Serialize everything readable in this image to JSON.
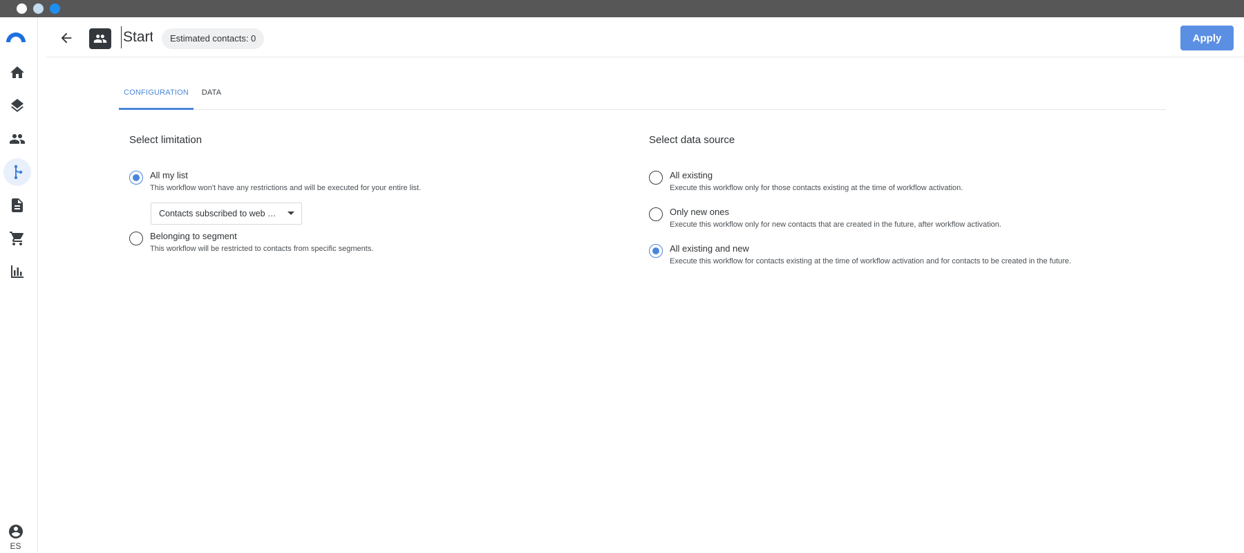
{
  "window": {
    "dots": [
      "#ffffff",
      "#c3dcef",
      "#1d8ff0"
    ]
  },
  "sidebar": {
    "items": [
      {
        "name": "home",
        "icon": "home-icon"
      },
      {
        "name": "layers",
        "icon": "layers-icon"
      },
      {
        "name": "contacts",
        "icon": "people-icon"
      },
      {
        "name": "workflows",
        "icon": "workflow-branch-icon",
        "active": true
      },
      {
        "name": "documents",
        "icon": "document-icon"
      },
      {
        "name": "shop",
        "icon": "cart-icon"
      },
      {
        "name": "reports",
        "icon": "bar-chart-icon"
      }
    ],
    "account_locale": "ES"
  },
  "header": {
    "title_value": "Start",
    "estimated_contacts": "Estimated contacts: 0",
    "apply_label": "Apply"
  },
  "tabs": [
    {
      "label": "CONFIGURATION",
      "active": true
    },
    {
      "label": "DATA",
      "active": false
    }
  ],
  "limitation": {
    "title": "Select limitation",
    "options": [
      {
        "label": "All my list",
        "description": "This workflow won't have any restrictions and will be executed for your entire list.",
        "checked": true
      },
      {
        "label": "Belonging to segment",
        "description": "This workflow will be restricted to contacts from specific segments.",
        "checked": false
      }
    ],
    "list_select_value": "Contacts subscribed to web …"
  },
  "data_source": {
    "title": "Select data source",
    "options": [
      {
        "label": "All existing",
        "description": "Execute this workflow only for those contacts existing at the time of workflow activation.",
        "checked": false
      },
      {
        "label": "Only new ones",
        "description": "Execute this workflow only for new contacts that are created in the future, after workflow activation.",
        "checked": false
      },
      {
        "label": "All existing and new",
        "description": "Execute this workflow for contacts existing at the time of workflow activation and for contacts to be created in the future.",
        "checked": true
      }
    ]
  },
  "colors": {
    "accent": "#4a86d8",
    "apply_button": "#5b8fe3",
    "titlebar": "#575757"
  }
}
